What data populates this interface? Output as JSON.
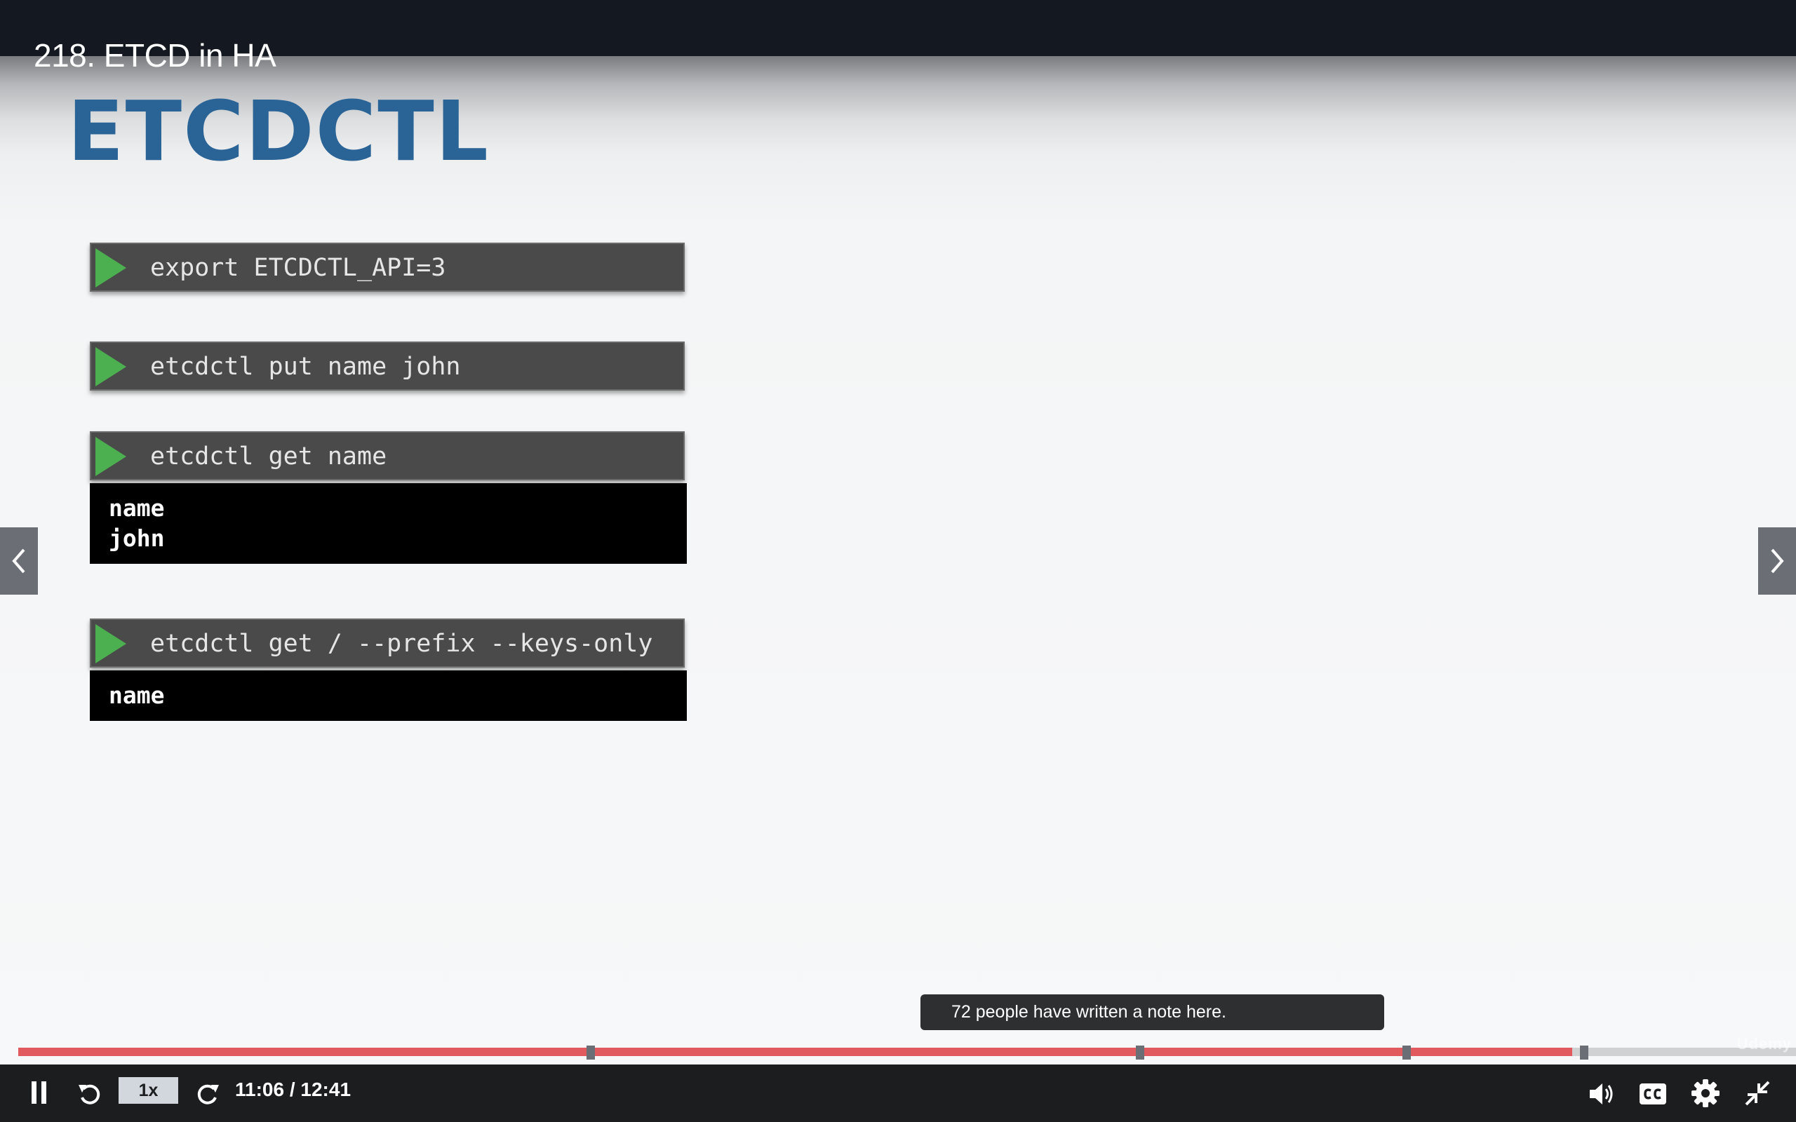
{
  "header": {
    "lecture_title": "218. ETCD in HA"
  },
  "slide": {
    "heading": "ETCDCTL",
    "commands": [
      {
        "text": "export ETCDCTL_API=3"
      },
      {
        "text": "etcdctl put name john"
      },
      {
        "text": "etcdctl get name",
        "output": [
          "name",
          "john"
        ]
      },
      {
        "text": "etcdctl get / --prefix --keys-only",
        "output": [
          "name"
        ]
      }
    ]
  },
  "player": {
    "tooltip": "72 people have written a note here.",
    "speed": "1x",
    "current_time": "11:06",
    "duration": "12:41",
    "time_display": "11:06 / 12:41",
    "progress_fraction": 0.874,
    "note_markers": [
      0.322,
      0.631,
      0.781,
      0.881
    ],
    "watermark": "Udemy",
    "colors": {
      "accent_progress": "#e05a5e",
      "play_triangle": "#4caf50",
      "heading": "#2a6496"
    },
    "icons": {
      "pause": "pause-icon",
      "rewind": "rewind-icon",
      "forward": "forward-icon",
      "volume": "volume-icon",
      "captions": "cc-icon",
      "settings": "gear-icon",
      "exit_fullscreen": "exit-fullscreen-icon",
      "prev": "chevron-left-icon",
      "next": "chevron-right-icon"
    }
  }
}
